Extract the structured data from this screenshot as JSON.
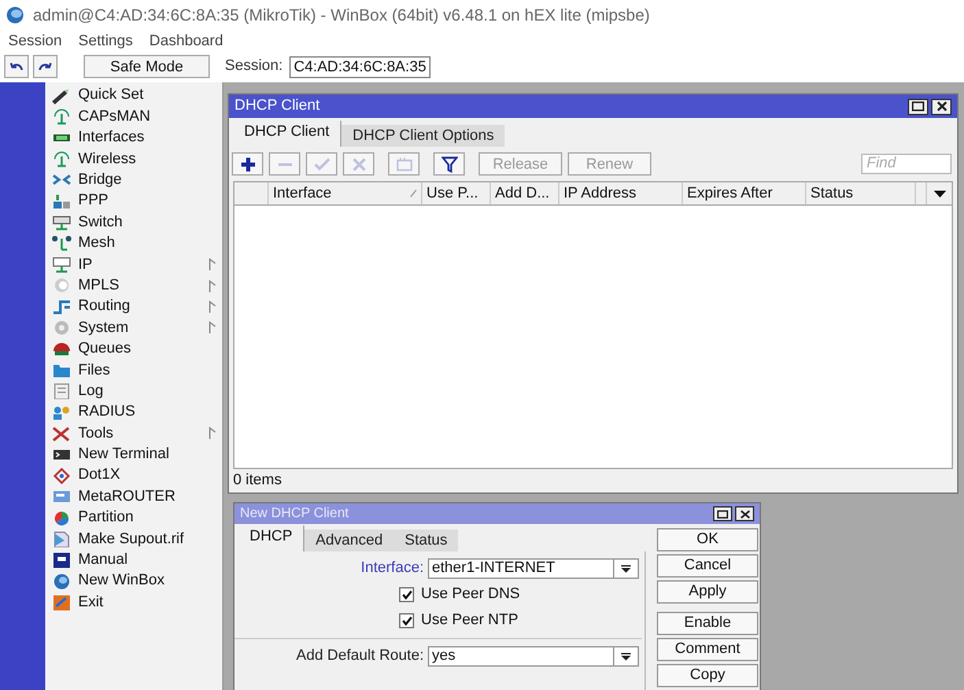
{
  "window": {
    "title": "admin@C4:AD:34:6C:8A:35 (MikroTik) - WinBox (64bit) v6.48.1 on hEX lite (mipsbe)"
  },
  "menu": [
    "Session",
    "Settings",
    "Dashboard"
  ],
  "toolbar": {
    "safe_mode": "Safe Mode",
    "session_label": "Session:",
    "session_value": "C4:AD:34:6C:8A:35"
  },
  "sidebar": {
    "items": [
      {
        "label": "Quick Set",
        "submenu": false
      },
      {
        "label": "CAPsMAN",
        "submenu": false
      },
      {
        "label": "Interfaces",
        "submenu": false
      },
      {
        "label": "Wireless",
        "submenu": false
      },
      {
        "label": "Bridge",
        "submenu": false
      },
      {
        "label": "PPP",
        "submenu": false
      },
      {
        "label": "Switch",
        "submenu": false
      },
      {
        "label": "Mesh",
        "submenu": false
      },
      {
        "label": "IP",
        "submenu": true
      },
      {
        "label": "MPLS",
        "submenu": true
      },
      {
        "label": "Routing",
        "submenu": true
      },
      {
        "label": "System",
        "submenu": true
      },
      {
        "label": "Queues",
        "submenu": false
      },
      {
        "label": "Files",
        "submenu": false
      },
      {
        "label": "Log",
        "submenu": false
      },
      {
        "label": "RADIUS",
        "submenu": false
      },
      {
        "label": "Tools",
        "submenu": true
      },
      {
        "label": "New Terminal",
        "submenu": false
      },
      {
        "label": "Dot1X",
        "submenu": false
      },
      {
        "label": "MetaROUTER",
        "submenu": false
      },
      {
        "label": "Partition",
        "submenu": false
      },
      {
        "label": "Make Supout.rif",
        "submenu": false
      },
      {
        "label": "Manual",
        "submenu": false
      },
      {
        "label": "New WinBox",
        "submenu": false
      },
      {
        "label": "Exit",
        "submenu": false
      }
    ]
  },
  "dhcp_window": {
    "title": "DHCP Client",
    "tabs": [
      {
        "label": "DHCP Client",
        "selected": true
      },
      {
        "label": "DHCP Client Options",
        "selected": false
      }
    ],
    "tools": [
      {
        "kind": "add",
        "disabled": false
      },
      {
        "kind": "remove",
        "disabled": true
      },
      {
        "kind": "enable",
        "disabled": true
      },
      {
        "kind": "disable",
        "disabled": true
      },
      {
        "kind": "comment",
        "disabled": true
      },
      {
        "kind": "filter",
        "disabled": false
      }
    ],
    "actions": [
      {
        "label": "Release",
        "disabled": true
      },
      {
        "label": "Renew",
        "disabled": true
      }
    ],
    "find": {
      "placeholder": "Find"
    },
    "columns": [
      "Interface",
      "Use P...",
      "Add D...",
      "IP Address",
      "Expires After",
      "Status"
    ],
    "status": "0 items"
  },
  "new_window": {
    "title": "New DHCP Client",
    "tabs": [
      {
        "label": "DHCP",
        "selected": true
      },
      {
        "label": "Advanced",
        "selected": false
      },
      {
        "label": "Status",
        "selected": false
      }
    ],
    "interface": {
      "label": "Interface:",
      "value": "ether1-INTERNET"
    },
    "options": [
      {
        "label": "Use Peer DNS",
        "checked": true
      },
      {
        "label": "Use Peer NTP",
        "checked": true
      }
    ],
    "default_route": {
      "label": "Add Default Route:",
      "value": "yes"
    },
    "buttons": [
      "OK",
      "Cancel",
      "Apply",
      "Enable",
      "Comment",
      "Copy"
    ]
  }
}
